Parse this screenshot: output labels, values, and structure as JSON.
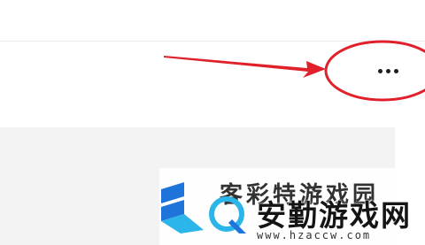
{
  "toolbar": {
    "more_icon": "ellipsis-icon",
    "more_label": "•••"
  },
  "annotation": {
    "color": "#e0202a",
    "shapes": [
      "arrow",
      "ellipse"
    ]
  },
  "watermark": {
    "back_title": "客彩特游戏园",
    "site_name": "安勤游戏网",
    "url": "www.hzaccw.com",
    "logo_colors": [
      "#1e74d9",
      "#2bb5e8"
    ]
  },
  "colors": {
    "page_background": "#ffffff",
    "panel_background": "#f3f3f3",
    "divider": "#ededed",
    "dots": "#1e1e1e"
  }
}
